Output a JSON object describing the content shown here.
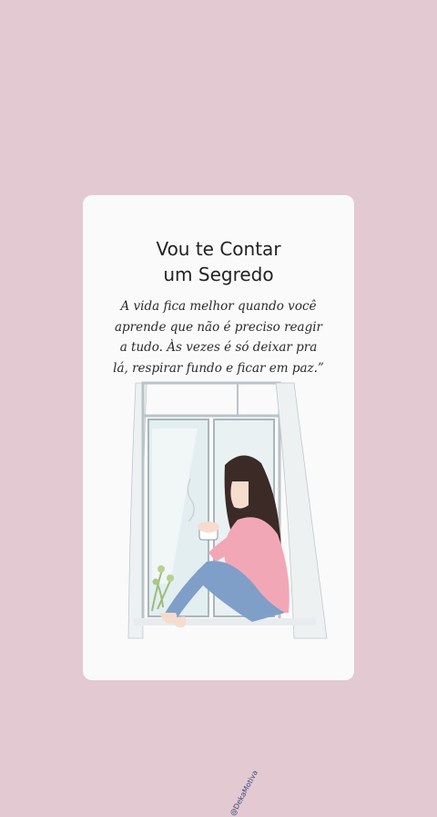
{
  "card": {
    "title_line1": "Vou te Contar",
    "title_line2": "um Segredo",
    "quote_lines": [
      "A vida fica melhor quando você",
      "aprende que não é preciso reagir",
      "a tudo. Às vezes é só deixar pra",
      "lá, respirar fundo e ficar em paz.”"
    ],
    "credit": "@DekaMotiva"
  },
  "colors": {
    "background": "#e2c9d2",
    "card": "#fbfafa",
    "sweater": "#f2a7b7",
    "jeans": "#7f9fc9",
    "hair": "#3b2a26"
  }
}
